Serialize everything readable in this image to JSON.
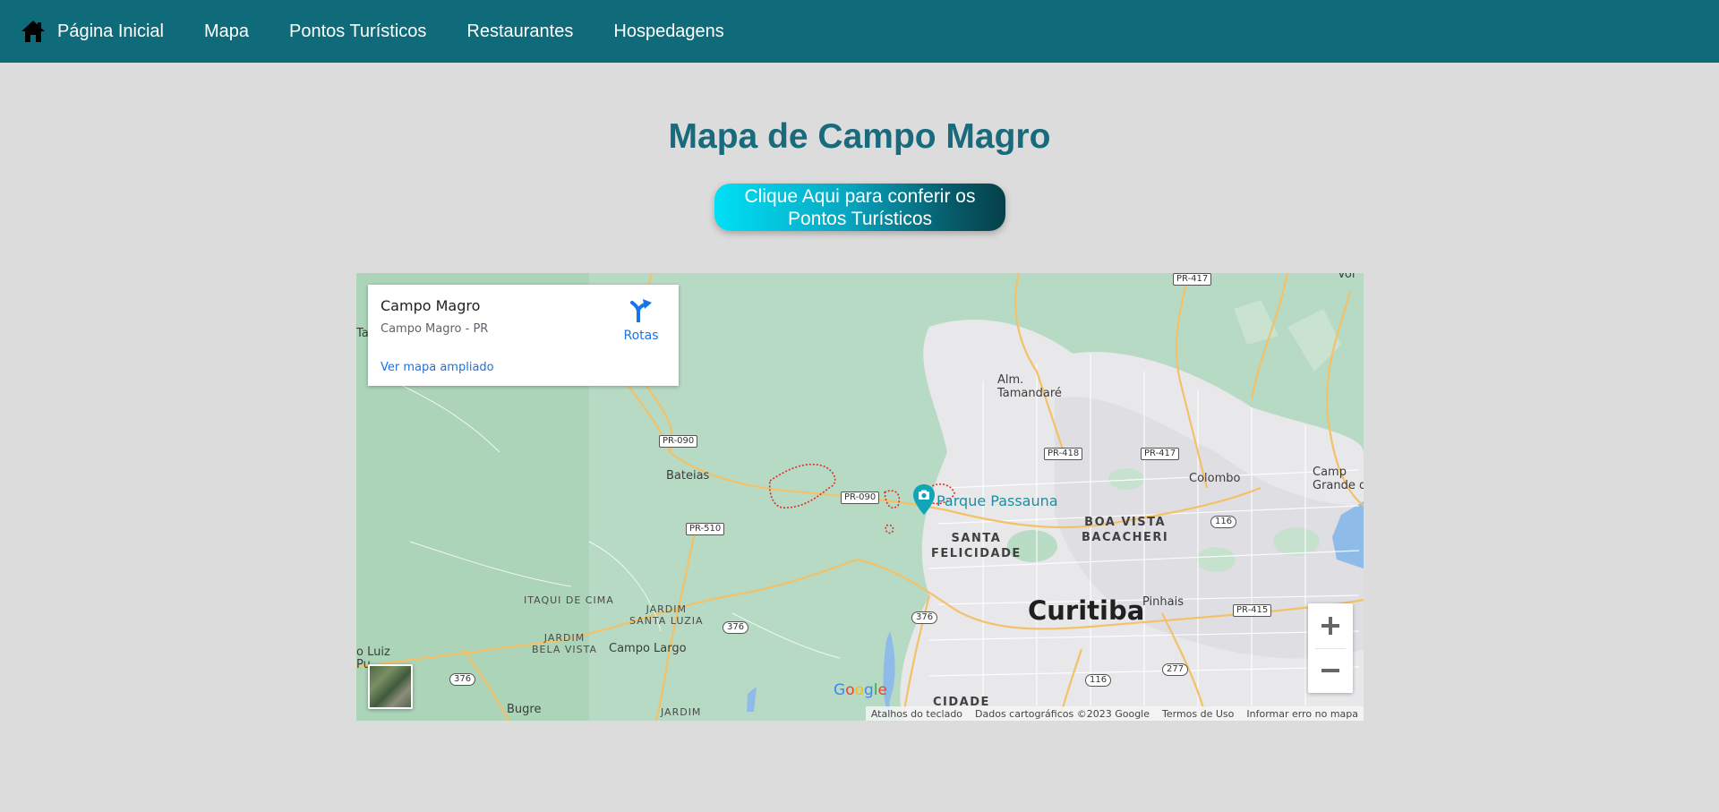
{
  "nav": {
    "home_label": "Página Inicial",
    "items": [
      "Mapa",
      "Pontos Turísticos",
      "Restaurantes",
      "Hospedagens"
    ]
  },
  "page": {
    "title": "Mapa de Campo Magro",
    "cta_line1": "Clique Aqui para conferir os",
    "cta_line2": "Pontos Turísticos"
  },
  "map": {
    "place_title": "Campo Magro",
    "place_subtitle": "Campo Magro - PR",
    "larger_map_link": "Ver mapa ampliado",
    "directions_label": "Rotas",
    "poi": "Parque Passauna",
    "city_main": "Curitiba",
    "labels": {
      "alm_tamandare_1": "Alm.",
      "alm_tamandare_2": "Tamandaré",
      "bateias": "Bateias",
      "colombo": "Colombo",
      "pinhais": "Pinhais",
      "campo_largo": "Campo Largo",
      "bugre": "Bugre",
      "campo_grande_1": "Camp",
      "campo_grande_2": "Grande d",
      "tan_edge": "Ta",
      "sao_luiz_1": "o Luiz",
      "sao_luiz_2": "Pu",
      "vol_edge": "Vol",
      "santa_felicidade_1": "SANTA",
      "santa_felicidade_2": "FELICIDADE",
      "boa_vista": "BOA VISTA",
      "bacacheri": "BACACHERI",
      "itaqui_de_cima": "ITAQUI DE CIMA",
      "jardim_santa_luzia_1": "JARDIM",
      "jardim_santa_luzia_2": "SANTA LUZIA",
      "jardim_bela_vista_1": "JARDIM",
      "jardim_bela_vista_2": "BELA VISTA",
      "cidade": "CIDADE",
      "jardim_bottom": "JARDIM"
    },
    "shields": {
      "pr417_top": "PR-417",
      "pr090_a": "PR-090",
      "pr090_b": "PR-090",
      "pr418": "PR-418",
      "pr417_mid": "PR-417",
      "pr510": "PR-510",
      "r116_a": "116",
      "r116_b": "116",
      "pr415": "PR-415",
      "r376_a": "376",
      "r376_b": "376",
      "r376_c": "376",
      "r277": "277"
    },
    "google_logo": "Google",
    "attribution": {
      "shortcuts": "Atalhos do teclado",
      "data": "Dados cartográficos ©2023 Google",
      "terms": "Termos de Uso",
      "report": "Informar erro no mapa"
    }
  },
  "colors": {
    "navbar": "#0f6a7a",
    "title": "#176b7d",
    "page_bg": "#dcdcdc",
    "map_green": "#b6dac4",
    "link_blue": "#1a73e8"
  }
}
